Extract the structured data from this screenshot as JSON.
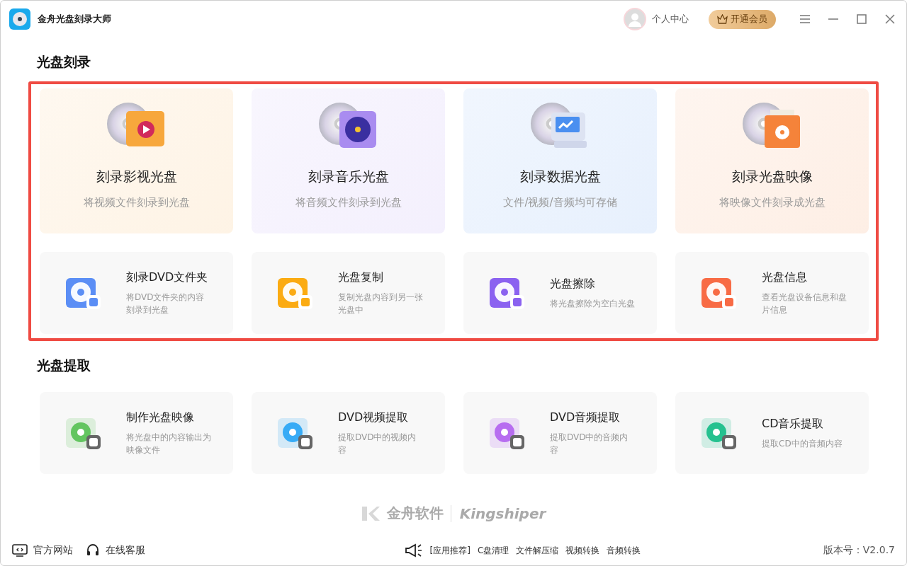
{
  "window": {
    "title": "金舟光盘刻录大师"
  },
  "header": {
    "user_label": "个人中心",
    "vip_button": "开通会员"
  },
  "sections": [
    {
      "title": "光盘刻录",
      "highlighted": true,
      "featured": [
        {
          "title": "刻录影视光盘",
          "subtitle": "将视频文件刻录到光盘",
          "color": "#f7a73c"
        },
        {
          "title": "刻录音乐光盘",
          "subtitle": "将音频文件刻录到光盘",
          "color": "#a98cf0"
        },
        {
          "title": "刻录数据光盘",
          "subtitle": "文件/视频/音频均可存储",
          "color": "#4a8ff0"
        },
        {
          "title": "刻录光盘映像",
          "subtitle": "将映像文件刻录成光盘",
          "color": "#f5833a"
        }
      ],
      "tools": [
        {
          "title": "刻录DVD文件夹",
          "subtitle": "将DVD文件夹的内容刻录到光盘",
          "color": "#5b8ef5"
        },
        {
          "title": "光盘复制",
          "subtitle": "复制光盘内容到另一张光盘中",
          "color": "#fbab12"
        },
        {
          "title": "光盘擦除",
          "subtitle": "将光盘擦除为空白光盘",
          "color": "#8b62f0"
        },
        {
          "title": "光盘信息",
          "subtitle": "查看光盘设备信息和盘片信息",
          "color": "#f86b45"
        }
      ]
    },
    {
      "title": "光盘提取",
      "highlighted": false,
      "tools": [
        {
          "title": "制作光盘映像",
          "subtitle": "将光盘中的内容输出为映像文件",
          "color": "#5cc25a"
        },
        {
          "title": "DVD视频提取",
          "subtitle": "提取DVD中的视频内容",
          "color": "#2ea8f5"
        },
        {
          "title": "DVD音频提取",
          "subtitle": "提取DVD中的音频内容",
          "color": "#b466ef"
        },
        {
          "title": "CD音乐提取",
          "subtitle": "提取CD中的音频内容",
          "color": "#1bbf8a"
        }
      ]
    }
  ],
  "brand": {
    "name": "金舟软件",
    "latin": "Kingshiper"
  },
  "footer": {
    "links": [
      "官方网站",
      "在线客服"
    ],
    "promo_label": "[应用推荐]",
    "promo_items": [
      "C盘清理",
      "文件解压缩",
      "视频转换",
      "音频转换"
    ],
    "version": "版本号：V2.0.7"
  }
}
